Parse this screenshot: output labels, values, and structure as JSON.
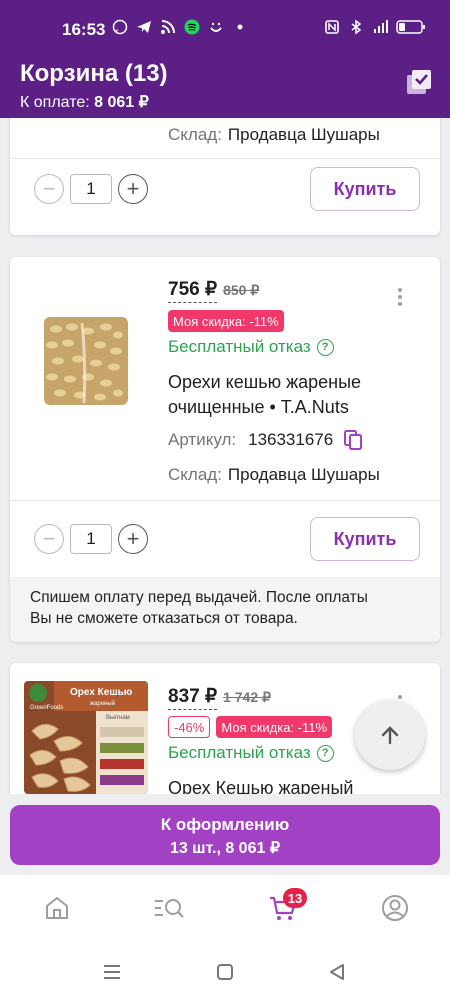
{
  "status_bar": {
    "time": "16:53"
  },
  "header": {
    "title": "Корзина (13)",
    "pay_label": "К оплате: ",
    "pay_amount": "8 061 ₽"
  },
  "item_top_partial": {
    "stock_label": "Склад:",
    "stock_value": "Продавца Шушары",
    "quantity": "1",
    "buy_label": "Купить"
  },
  "item_cashew_tanuts": {
    "price": "756 ₽",
    "old_price": "850 ₽",
    "my_discount": "Моя скидка: -11%",
    "free_return": "Бесплатный отказ",
    "name_line1": "Орехи кешью жареные",
    "name_line2": "очищенные • T.A.Nuts",
    "article_label": "Артикул:",
    "article_value": "136331676",
    "stock_label": "Склад:",
    "stock_value": "Продавца Шушары",
    "quantity": "1",
    "buy_label": "Купить",
    "note_line1": "Спишем оплату перед выдачей. После оплаты",
    "note_line2": "Вы не сможете отказаться от товара."
  },
  "item_cashew_greenfoods": {
    "price": "837 ₽",
    "old_price": "1 742 ₽",
    "discount": "-46%",
    "my_discount": "Моя скидка: -11%",
    "free_return": "Бесплатный отказ",
    "name_line1": "Орех Кешью жареный",
    "thumb_brand": "GreenFoods",
    "thumb_title": "Орех Кешью",
    "thumb_sub": "жареный",
    "thumb_country": "Вьетнам"
  },
  "checkout": {
    "label": "К оформлению",
    "summary": "13 шт., 8 061 ₽"
  },
  "bottom_nav": {
    "cart_count": "13"
  },
  "colors": {
    "header": "#5b1f85",
    "accent": "#a241c4",
    "sale": "#f0386b",
    "free_return": "#2aa44f"
  }
}
